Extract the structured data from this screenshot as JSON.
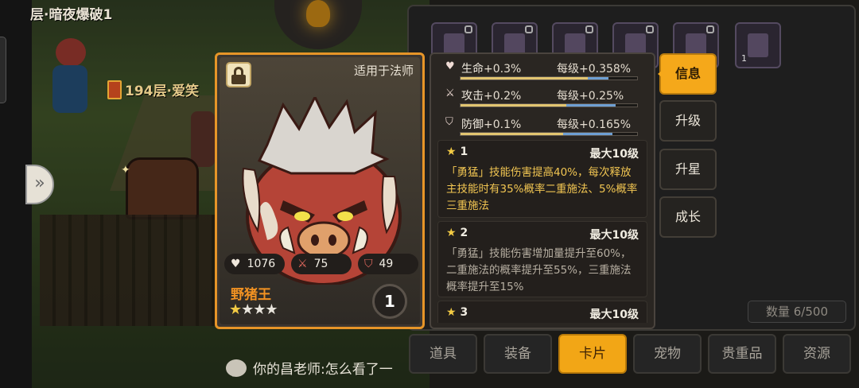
{
  "scene": {
    "floor_top_label": "层·暗夜爆破1",
    "floor_mid_label": "194层·爱笑",
    "chat_text": "你的昌老师:怎么看了一"
  },
  "inventory": {
    "slot_count_label": "1",
    "capacity_label": "数量 6/500",
    "tabs": [
      {
        "label": "道具"
      },
      {
        "label": "装备"
      },
      {
        "label": "卡片",
        "active": true
      },
      {
        "label": "宠物"
      },
      {
        "label": "贵重品"
      },
      {
        "label": "资源"
      }
    ]
  },
  "card": {
    "apply_text": "适用于法师",
    "name": "野猪王",
    "stars_total": 4,
    "stars_filled": 1,
    "level": "1",
    "hp": "1076",
    "atk": "75",
    "def": "49"
  },
  "attributes": [
    {
      "name": "生命",
      "value": "+0.3%",
      "per_label": "每级",
      "per_value": "+0.358%",
      "icon": "heart-icon",
      "fill": 0.72,
      "fill2": 0.12
    },
    {
      "name": "攻击",
      "value": "+0.2%",
      "per_label": "每级",
      "per_value": "+0.25%",
      "icon": "sword-icon",
      "fill": 0.6,
      "fill2": 0.28
    },
    {
      "name": "防御",
      "value": "+0.1%",
      "per_label": "每级",
      "per_value": "+0.165%",
      "icon": "shield-icon",
      "fill": 0.58,
      "fill2": 0.28
    }
  ],
  "skills": [
    {
      "star": "★",
      "level": "1",
      "max": "最大10级",
      "text": "「勇猛」技能伤害提高40%，每次释放主技能时有35%概率二重施法、5%概率三重施法",
      "active": true
    },
    {
      "star": "★",
      "level": "2",
      "max": "最大10级",
      "text": "「勇猛」技能伤害增加量提升至60%，二重施法的概率提升至55%，三重施法概率提升至15%",
      "active": false
    },
    {
      "star": "★",
      "level": "3",
      "max": "最大10级",
      "text": "",
      "active": false
    }
  ],
  "side_buttons": [
    {
      "label": "信息",
      "active": true
    },
    {
      "label": "升级"
    },
    {
      "label": "升星"
    },
    {
      "label": "成长"
    }
  ],
  "colors": {
    "accent": "#f5a81a",
    "card_border": "#e69528",
    "name": "#f29222",
    "skill_active": "#f2c652"
  }
}
